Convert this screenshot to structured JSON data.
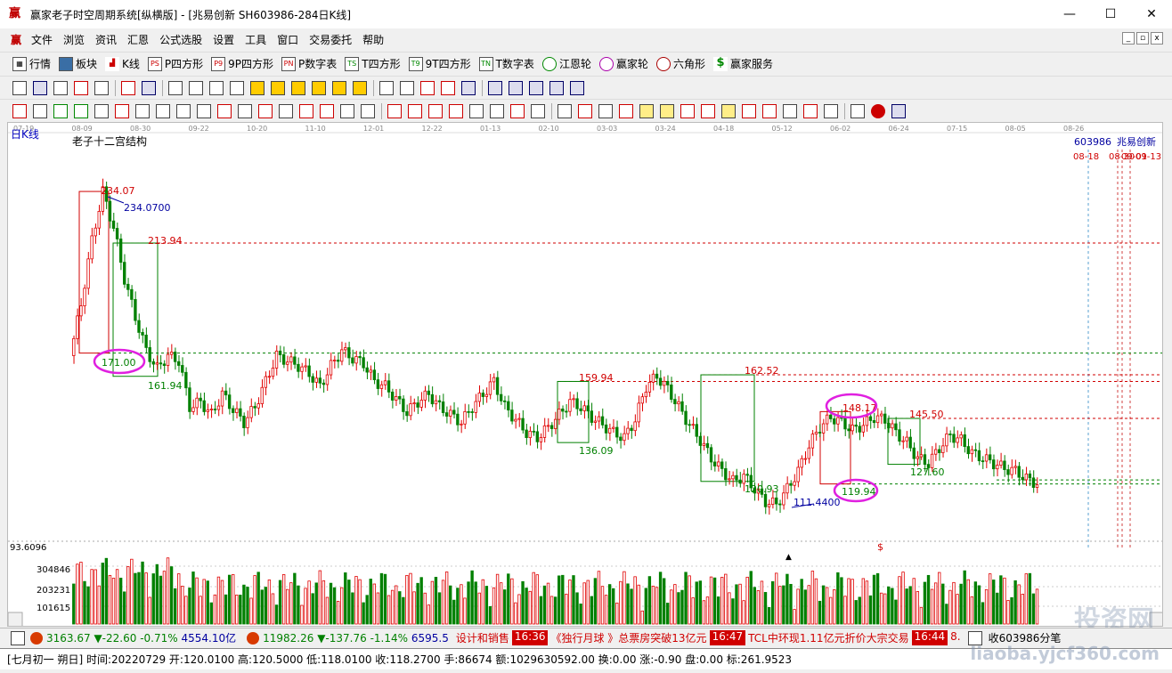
{
  "window": {
    "title": "赢家老子时空周期系统[纵横版] - [兆易创新  SH603986-284日K线]",
    "app_icon": "赢",
    "controls": [
      "—",
      "☐",
      "✕"
    ]
  },
  "menu": {
    "items": [
      "文件",
      "浏览",
      "资讯",
      "汇恩",
      "公式选股",
      "设置",
      "工具",
      "窗口",
      "交易委托",
      "帮助"
    ],
    "mdi_controls": [
      "_",
      "▫",
      "x"
    ]
  },
  "toolbar_main": [
    {
      "icon": "table-icon",
      "label": "行情"
    },
    {
      "icon": "blocks-icon",
      "label": "板块"
    },
    {
      "icon": "kline-icon",
      "label": "K线"
    },
    {
      "icon": "ps-icon",
      "label": "P四方形"
    },
    {
      "icon": "p9-icon",
      "label": "9P四方形"
    },
    {
      "icon": "pn-icon",
      "label": "P数字表"
    },
    {
      "icon": "ts-icon",
      "label": "T四方形"
    },
    {
      "icon": "t9-icon",
      "label": "9T四方形"
    },
    {
      "icon": "tn-icon",
      "label": "T数字表"
    },
    {
      "icon": "wheel-icon",
      "label": "江恩轮"
    },
    {
      "icon": "wheel2-icon",
      "label": "赢家轮"
    },
    {
      "icon": "hexagon-icon",
      "label": "六角形"
    },
    {
      "icon": "dollar-icon",
      "label": "赢家服务"
    }
  ],
  "toolbar_icon_badges": [
    "PS",
    "P9",
    "PN",
    "TS",
    "T9",
    "TN"
  ],
  "chart": {
    "period_label": "日K线",
    "indicator_title": "老子十二宫结构",
    "stock_code": "603986",
    "stock_name": "兆易创新",
    "date_ticks": [
      "07-19",
      "08-09",
      "08-30",
      "09-22",
      "10-20",
      "11-10",
      "12-01",
      "12-22",
      "01-13",
      "02-10",
      "03-03",
      "03-24",
      "04-18",
      "05-12",
      "06-02",
      "06-24",
      "07-15",
      "08-05",
      "08-26"
    ],
    "future_dates": [
      "08-18",
      "08-30",
      "09-01",
      "09-13"
    ],
    "price_labels": [
      {
        "text": "234.07",
        "color": "#d00000"
      },
      {
        "text": "234.0700",
        "color": "#0000a0"
      },
      {
        "text": "213.94",
        "color": "#d00000"
      },
      {
        "text": "171.00",
        "color": "#008000"
      },
      {
        "text": "161.94",
        "color": "#008000"
      },
      {
        "text": "159.94",
        "color": "#d00000"
      },
      {
        "text": "136.09",
        "color": "#008000"
      },
      {
        "text": "162.52",
        "color": "#d00000"
      },
      {
        "text": "120.93",
        "color": "#008000"
      },
      {
        "text": "111.4400",
        "color": "#0000a0"
      },
      {
        "text": "148.17",
        "color": "#d00000"
      },
      {
        "text": "119.94",
        "color": "#008000"
      },
      {
        "text": "145.50",
        "color": "#d00000"
      },
      {
        "text": "127.60",
        "color": "#008000"
      }
    ],
    "dollar_mark": "$",
    "volume_axis": [
      "93.6096",
      "304846",
      "203231",
      "101615"
    ]
  },
  "chart_data": {
    "type": "candlestick",
    "x_range": [
      "2021-07-19",
      "2022-07-29"
    ],
    "y_range": [
      108,
      240
    ],
    "key_levels": [
      234.07,
      213.94,
      171.0,
      161.94,
      159.94,
      136.09,
      162.52,
      120.93,
      111.44,
      148.17,
      119.94,
      145.5,
      127.6
    ],
    "close_path": [
      170,
      190,
      215,
      234,
      220,
      200,
      185,
      172,
      165,
      170,
      168,
      150,
      152,
      147,
      155,
      149,
      144,
      150,
      160,
      170,
      168,
      166,
      163,
      158,
      166,
      172,
      169,
      167,
      160,
      158,
      153,
      148,
      152,
      155,
      150,
      147,
      144,
      150,
      155,
      160,
      150,
      145,
      140,
      138,
      142,
      147,
      152,
      150,
      146,
      143,
      140,
      138,
      145,
      158,
      162,
      157,
      150,
      143,
      137,
      130,
      125,
      121,
      123,
      118,
      113,
      112,
      118,
      125,
      135,
      142,
      146,
      144,
      141,
      143,
      146,
      145,
      140,
      136,
      130,
      128,
      134,
      139,
      137,
      132,
      130,
      128,
      126,
      125,
      122,
      120
    ]
  },
  "statusbar": {
    "sh_value": "3163.67",
    "sh_change": "▼-22.60",
    "sh_pct": "-0.71%",
    "sh_amount": "4554.10亿",
    "sz_value": "11982.26",
    "sz_change": "▼-137.76",
    "sz_pct": "-1.14%",
    "sz_amount": "6595.5",
    "ticker_1_text": "设计和销售",
    "ticker_2_time": "16:36",
    "ticker_2_text": "《独行月球 》总票房突破13亿元",
    "ticker_3_time": "16:47",
    "ticker_3_text": "TCL中环现1.11亿元折价大宗交易",
    "ticker_4_time": "16:44",
    "ticker_4_text": "8.",
    "right_text": "收603986分笔"
  },
  "infobar": {
    "text": "[七月初一  朔日] 时间:20220729 开:120.0100 高:120.5000 低:118.0100 收:118.2700 手:86674 额:1029630592.00 换:0.00 涨:-0.90 盘:0.00 标:261.9523"
  },
  "watermark": {
    "text": "投资网",
    "url_text": "liaoba.yjcf360.com"
  }
}
